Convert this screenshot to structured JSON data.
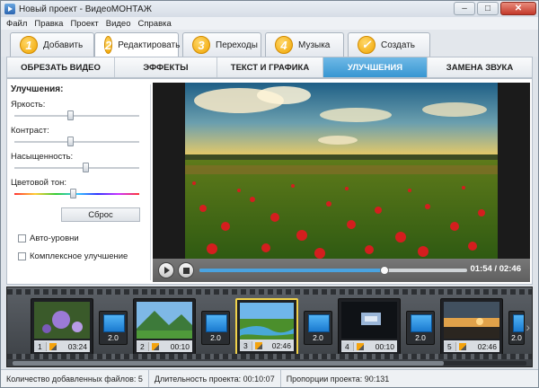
{
  "window": {
    "title": "Новый проект - ВидеоМОНТАЖ",
    "minimize": "–",
    "maximize": "□",
    "close": "✕"
  },
  "menu": [
    "Файл",
    "Правка",
    "Проект",
    "Видео",
    "Справка"
  ],
  "main_tabs": [
    {
      "num": "1",
      "label": "Добавить"
    },
    {
      "num": "2",
      "label": "Редактировать"
    },
    {
      "num": "3",
      "label": "Переходы"
    },
    {
      "num": "4",
      "label": "Музыка"
    },
    {
      "num": "",
      "label": "Создать"
    }
  ],
  "sub_tabs": [
    "ОБРЕЗАТЬ ВИДЕО",
    "ЭФФЕКТЫ",
    "ТЕКСТ И ГРАФИКА",
    "УЛУЧШЕНИЯ",
    "ЗАМЕНА ЗВУКА"
  ],
  "panel": {
    "title": "Улучшения:",
    "sliders": [
      {
        "label": "Яркость:",
        "level": 0.46
      },
      {
        "label": "Контраст:",
        "level": 0.46
      },
      {
        "label": "Насыщенность:",
        "level": 0.58
      },
      {
        "label": "Цветовой тон:",
        "level": 0.48
      }
    ],
    "reset": "Сброс",
    "checkboxes": [
      "Авто-уровни",
      "Комплексное улучшение"
    ]
  },
  "player": {
    "time": "01:54 / 02:46",
    "progress": 0.69
  },
  "clips": [
    {
      "num": "1",
      "dur": "03:24"
    },
    {
      "num": "2",
      "dur": "00:10"
    },
    {
      "num": "3",
      "dur": "02:46"
    },
    {
      "num": "4",
      "dur": "00:10"
    },
    {
      "num": "5",
      "dur": "02:46"
    }
  ],
  "transitions": [
    "2.0",
    "2.0",
    "2.0",
    "2.0",
    "2.0"
  ],
  "status": {
    "files": "Количество добавленных файлов: 5",
    "duration": "Длительность проекта:  00:10:07",
    "ratio": "Пропорции проекта:  90:131"
  },
  "colors": {
    "accent": "#3796d2",
    "tab_num": "#f0a400",
    "selected_clip": "#f0d24a"
  }
}
